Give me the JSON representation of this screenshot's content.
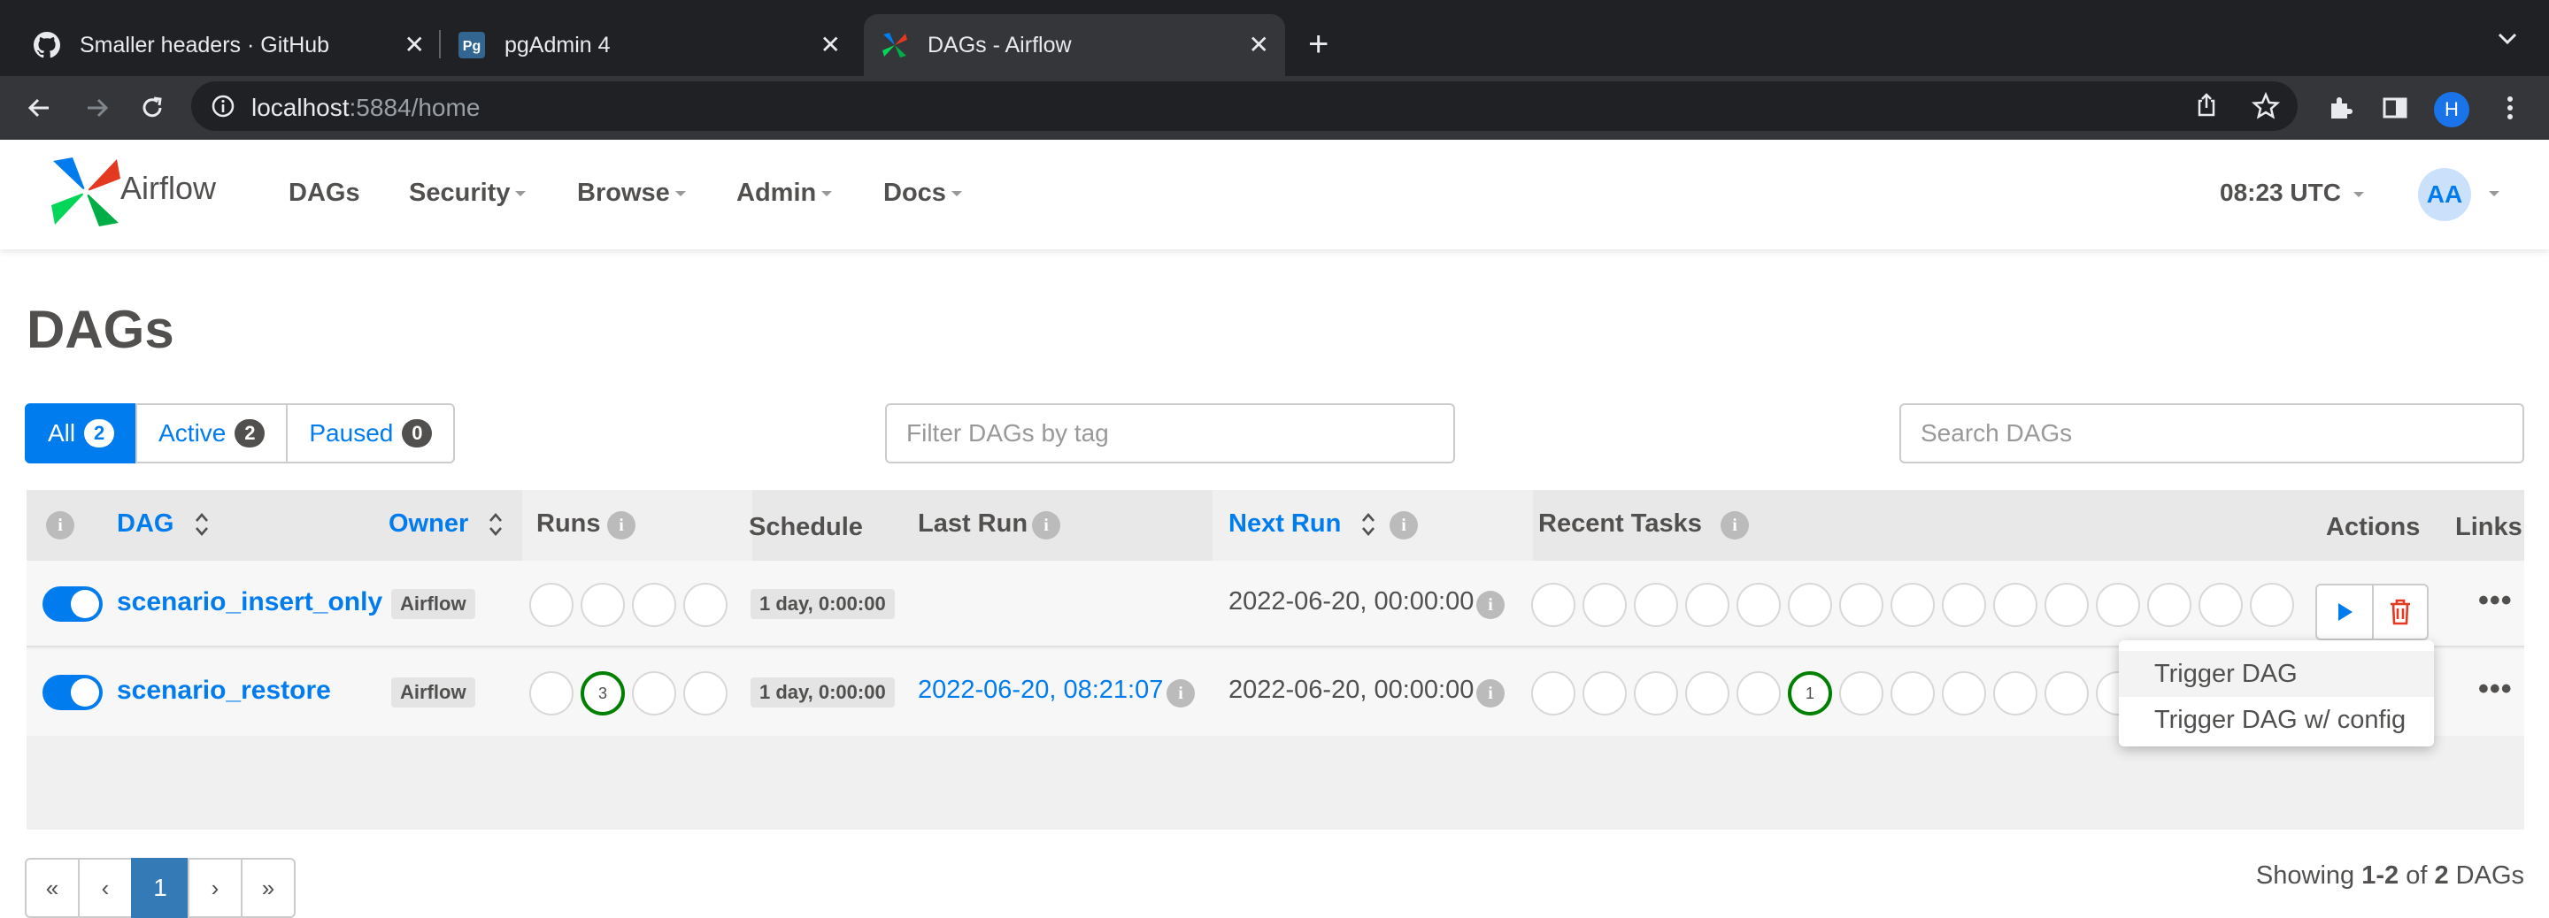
{
  "browser": {
    "tabs": [
      {
        "title": "Smaller headers · GitHub",
        "icon": "github-icon"
      },
      {
        "title": "pgAdmin 4",
        "icon": "pgadmin-icon"
      },
      {
        "title": "DAGs - Airflow",
        "icon": "airflow-icon",
        "active": true
      }
    ],
    "url_host": "localhost",
    "url_rest": ":5884/home",
    "profile_initial": "H"
  },
  "nav": {
    "brand": "Airflow",
    "items": [
      "DAGs",
      "Security",
      "Browse",
      "Admin",
      "Docs"
    ],
    "clock": "08:23 UTC",
    "user_initials": "AA"
  },
  "page": {
    "title": "DAGs",
    "filters": [
      {
        "label": "All",
        "count": "2"
      },
      {
        "label": "Active",
        "count": "2"
      },
      {
        "label": "Paused",
        "count": "0"
      }
    ],
    "tag_placeholder": "Filter DAGs by tag",
    "search_placeholder": "Search DAGs"
  },
  "table": {
    "headers": {
      "dag": "DAG",
      "owner": "Owner",
      "runs": "Runs",
      "schedule": "Schedule",
      "last_run": "Last Run",
      "next_run": "Next Run",
      "recent_tasks": "Recent Tasks",
      "actions": "Actions",
      "links": "Links"
    },
    "rows": [
      {
        "dag_id": "scenario_insert_only",
        "owner": "Airflow",
        "schedule": "1 day, 0:00:00",
        "last_run": "",
        "next_run": "2022-06-20, 00:00:00",
        "runs": [
          "",
          "",
          "",
          ""
        ],
        "recent_tasks": [
          "",
          "",
          "",
          "",
          "",
          "",
          "",
          "",
          "",
          "",
          "",
          "",
          "",
          "",
          ""
        ]
      },
      {
        "dag_id": "scenario_restore",
        "owner": "Airflow",
        "schedule": "1 day, 0:00:00",
        "last_run": "2022-06-20, 08:21:07",
        "next_run": "2022-06-20, 00:00:00",
        "runs": [
          "",
          "3",
          "",
          ""
        ],
        "recent_tasks": [
          "",
          "",
          "",
          "",
          "",
          "1",
          "",
          "",
          "",
          "",
          "",
          ""
        ]
      }
    ]
  },
  "dropdown": {
    "items": [
      "Trigger DAG",
      "Trigger DAG w/ config"
    ]
  },
  "pagination": {
    "first": "«",
    "prev": "‹",
    "current": "1",
    "next": "›",
    "last": "»"
  },
  "footer": {
    "prefix": "Showing",
    "range": "1-2",
    "of": "of",
    "total": "2",
    "suffix": "DAGs"
  },
  "colors": {
    "accent": "#017cee",
    "success": "#008000",
    "delete": "#e43921"
  }
}
